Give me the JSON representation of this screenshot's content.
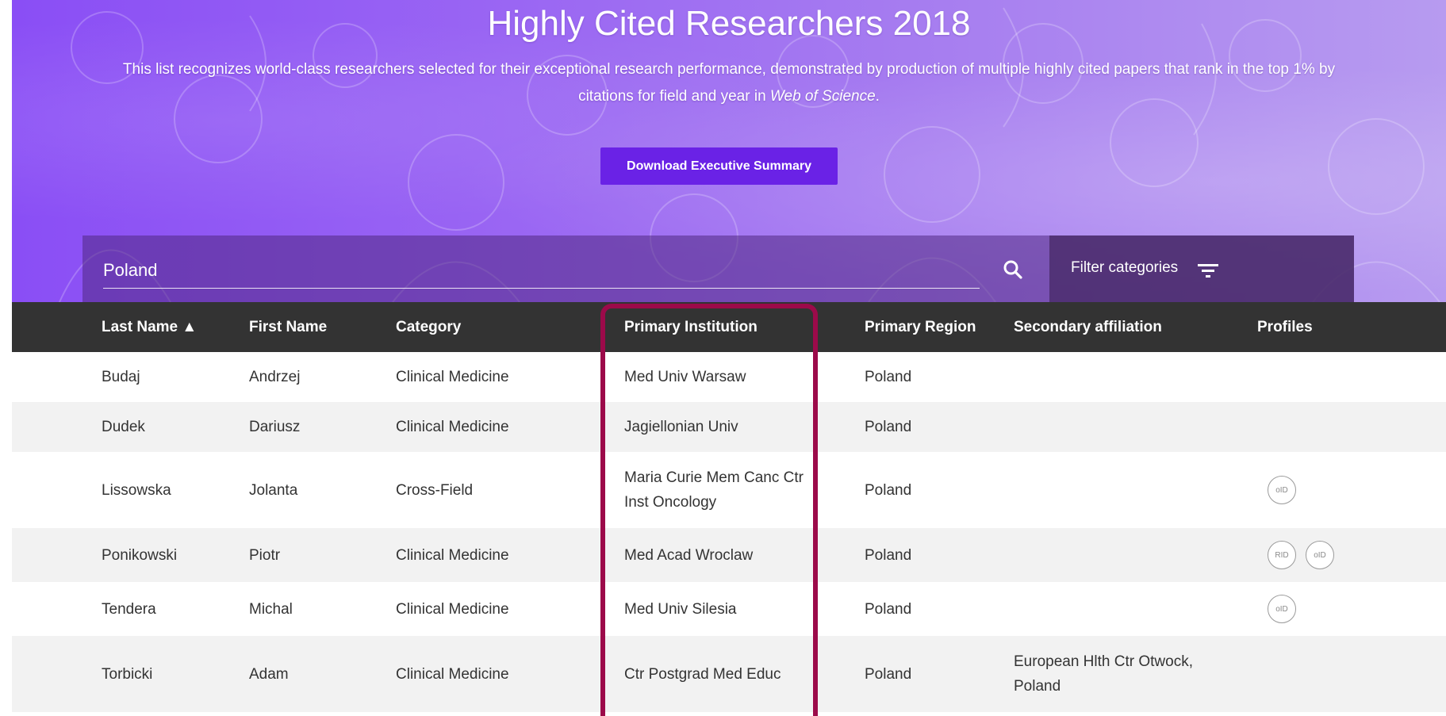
{
  "hero": {
    "title": "Highly Cited Researchers 2018",
    "subtitle_main": "This list recognizes world-class researchers selected for their exceptional research performance, demonstrated by production of multiple highly cited papers that rank in the top 1% by citations for field and year in",
    "subtitle_em": "Web of Science",
    "subtitle_end": ".",
    "download_label": "Download Executive Summary"
  },
  "search": {
    "value": "Poland",
    "filter_label": "Filter categories"
  },
  "table": {
    "headers": {
      "last_name": "Last Name ▲",
      "first_name": "First Name",
      "category": "Category",
      "primary_institution": "Primary Institution",
      "primary_region": "Primary Region",
      "secondary_affiliation": "Secondary affiliation",
      "profiles": "Profiles"
    },
    "rows": [
      {
        "last_name": "Budaj",
        "first_name": "Andrzej",
        "category": "Clinical Medicine",
        "institution": "Med Univ Warsaw",
        "region": "Poland",
        "secondary": "",
        "profiles": []
      },
      {
        "last_name": "Dudek",
        "first_name": "Dariusz",
        "category": "Clinical Medicine",
        "institution": "Jagiellonian Univ",
        "region": "Poland",
        "secondary": "",
        "profiles": []
      },
      {
        "last_name": "Lissowska",
        "first_name": "Jolanta",
        "category": "Cross-Field",
        "institution": "Maria Curie Mem Canc Ctr Inst Oncology",
        "region": "Poland",
        "secondary": "",
        "profiles": [
          "orcid-icon"
        ]
      },
      {
        "last_name": "Ponikowski",
        "first_name": "Piotr",
        "category": "Clinical Medicine",
        "institution": "Med Acad Wroclaw",
        "region": "Poland",
        "secondary": "",
        "profiles": [
          "researcherid-icon",
          "orcid-icon"
        ]
      },
      {
        "last_name": "Tendera",
        "first_name": "Michal",
        "category": "Clinical Medicine",
        "institution": "Med Univ Silesia",
        "region": "Poland",
        "secondary": "",
        "profiles": [
          "orcid-icon"
        ]
      },
      {
        "last_name": "Torbicki",
        "first_name": "Adam",
        "category": "Clinical Medicine",
        "institution": "Ctr Postgrad Med Educ",
        "region": "Poland",
        "secondary": "European Hlth Ctr Otwock, Poland",
        "profiles": []
      }
    ]
  },
  "colors": {
    "button": "#6a22e6",
    "header_bg": "#333333",
    "highlight": "#9c0a4a",
    "row_alt": "#f2f2f2"
  }
}
